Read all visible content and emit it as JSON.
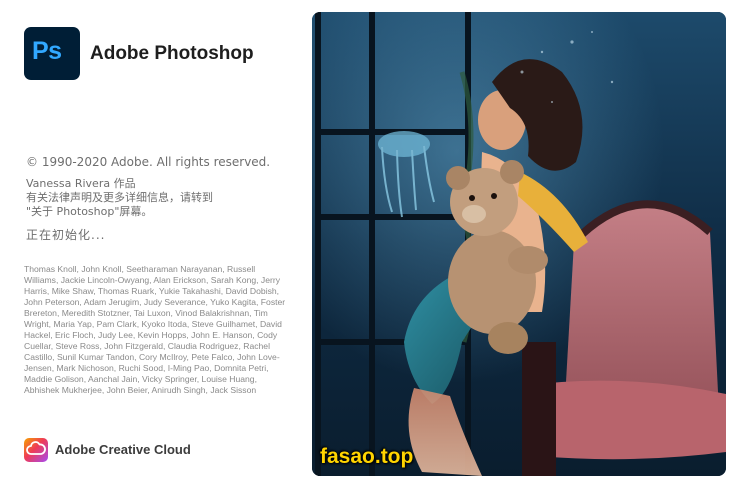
{
  "app": {
    "logo_letters": "Ps",
    "title": "Adobe Photoshop",
    "brand_color": "#31a8ff",
    "tile_color": "#001e36"
  },
  "copyright": "© 1990-2020 Adobe. All rights reserved.",
  "credit": {
    "line1": "Vanessa Rivera  作品",
    "line2": "有关法律声明及更多详细信息，请转到",
    "line3": "\"关于 Photoshop\"屏幕。"
  },
  "status": "正在初始化...",
  "contributors": "Thomas Knoll, John Knoll, Seetharaman Narayanan, Russell Williams, Jackie Lincoln-Owyang, Alan Erickson, Sarah Kong, Jerry Harris, Mike Shaw, Thomas Ruark, Yukie Takahashi, David Dobish, John Peterson, Adam Jerugim, Judy Severance, Yuko Kagita, Foster Brereton, Meredith Stotzner, Tai Luxon, Vinod Balakrishnan, Tim Wright, Maria Yap, Pam Clark, Kyoko Itoda, Steve Guilhamet, David Hackel, Eric Floch, Judy Lee, Kevin Hopps, John E. Hanson, Cody Cuellar, Steve Ross, John Fitzgerald, Claudia Rodriguez, Rachel Castillo, Sunil Kumar Tandon, Cory McIlroy, Pete Falco, John Love-Jensen, Mark Nichoson, Ruchi Sood, I-Ming Pao, Domnita Petri, Maddie Golison, Aanchal Jain, Vicky Springer, Louise Huang, Abhishek Mukherjee, John Beier, Anirudh Singh, Jack Sisson",
  "creative_cloud": {
    "label": "Adobe Creative Cloud",
    "icon": "creative-cloud-icon"
  },
  "watermark": "fasao.top",
  "watermark_color": "#ffd400"
}
